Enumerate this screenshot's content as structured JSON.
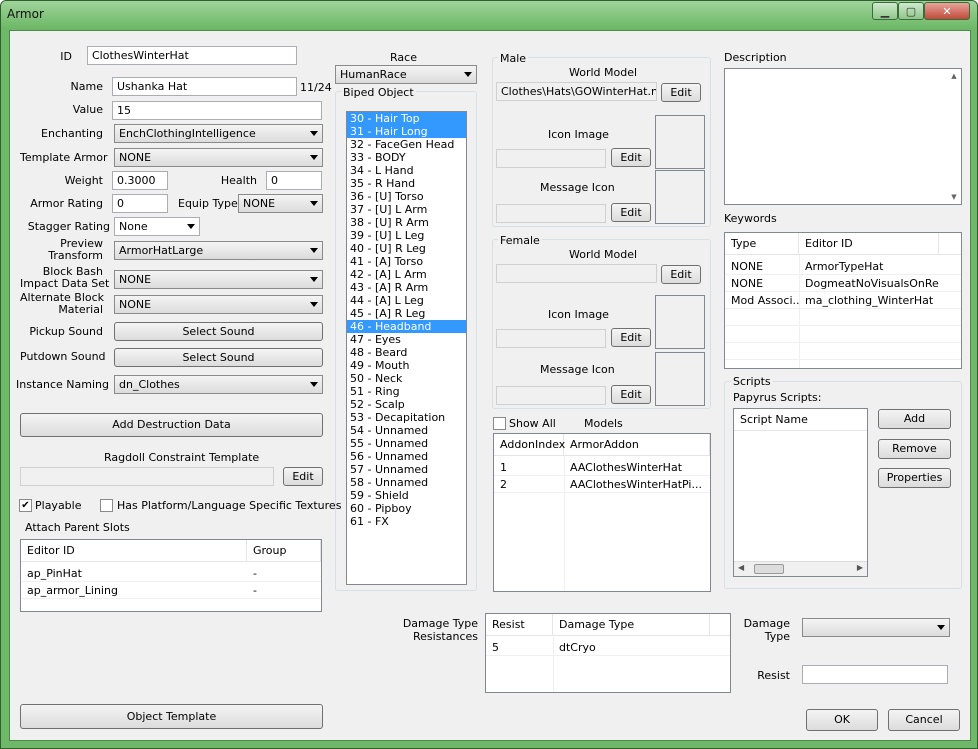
{
  "window": {
    "title": "Armor"
  },
  "left": {
    "id_label": "ID",
    "id_value": "ClothesWinterHat",
    "name_label": "Name",
    "name_value": "Ushanka Hat",
    "name_count": "11/24",
    "value_label": "Value",
    "value_value": "15",
    "enchanting_label": "Enchanting",
    "enchanting_value": "EnchClothingIntelligence",
    "template_label": "Template Armor",
    "template_value": "NONE",
    "weight_label": "Weight",
    "weight_value": "0.3000",
    "health_label": "Health",
    "health_value": "0",
    "armor_rating_label": "Armor Rating",
    "armor_rating_value": "0",
    "equip_type_label": "Equip Type",
    "equip_type_value": "NONE",
    "stagger_label": "Stagger Rating",
    "stagger_value": "None",
    "preview_label_1": "Preview",
    "preview_label_2": "Transform",
    "preview_value": "ArmorHatLarge",
    "bash_label_1": "Block Bash",
    "bash_label_2": "Impact Data Set",
    "bash_value": "NONE",
    "altblock_label_1": "Alternate Block",
    "altblock_label_2": "Material",
    "altblock_value": "NONE",
    "pickup_label": "Pickup Sound",
    "pickup_button": "Select Sound",
    "putdown_label": "Putdown Sound",
    "putdown_button": "Select Sound",
    "instance_label": "Instance Naming",
    "instance_value": "dn_Clothes",
    "destruction_button": "Add Destruction Data",
    "ragdoll_label": "Ragdoll Constraint Template",
    "ragdoll_edit": "Edit",
    "playable_label": "Playable",
    "platform_label": "Has Platform/Language Specific Textures",
    "attach_label": "Attach Parent Slots",
    "attach_cols": [
      "Editor ID",
      "Group"
    ],
    "attach_rows": [
      [
        "ap_PinHat",
        "-"
      ],
      [
        "ap_armor_Lining",
        "-"
      ]
    ],
    "object_template_button": "Object Template"
  },
  "race": {
    "label": "Race",
    "value": "HumanRace"
  },
  "biped": {
    "label": "Biped Object",
    "items": [
      "30 - Hair Top",
      "31 - Hair Long",
      "32 - FaceGen Head",
      "33 - BODY",
      "34 - L Hand",
      "35 - R Hand",
      "36 - [U] Torso",
      "37 - [U] L Arm",
      "38 - [U] R Arm",
      "39 - [U] L Leg",
      "40 - [U] R Leg",
      "41 - [A] Torso",
      "42 - [A] L Arm",
      "43 - [A] R Arm",
      "44 - [A] L Leg",
      "45 - [A] R Leg",
      "46 - Headband",
      "47 - Eyes",
      "48 - Beard",
      "49 - Mouth",
      "50 - Neck",
      "51 - Ring",
      "52 - Scalp",
      "53 - Decapitation",
      "54 - Unnamed",
      "55 - Unnamed",
      "56 - Unnamed",
      "57 - Unnamed",
      "58 - Unnamed",
      "59 - Shield",
      "60 - Pipboy",
      "61 - FX"
    ],
    "selected": [
      0,
      1,
      16
    ]
  },
  "male": {
    "label": "Male",
    "world_model_label": "World Model",
    "world_model_value": "Clothes\\Hats\\GOWinterHat.nif",
    "edit": "Edit",
    "icon_label": "Icon Image",
    "message_label": "Message Icon"
  },
  "female": {
    "label": "Female",
    "world_model_label": "World Model",
    "edit": "Edit",
    "icon_label": "Icon Image",
    "message_label": "Message Icon"
  },
  "models": {
    "show_all": "Show All",
    "label": "Models",
    "cols": [
      "AddonIndex",
      "ArmorAddon"
    ],
    "rows": [
      [
        "1",
        "AAClothesWinterHat"
      ],
      [
        "2",
        "AAClothesWinterHatPi..."
      ]
    ]
  },
  "right": {
    "description_label": "Description",
    "keywords_label": "Keywords",
    "keywords_cols": [
      "Type",
      "Editor ID"
    ],
    "keywords_rows": [
      [
        "NONE",
        "ArmorTypeHat"
      ],
      [
        "NONE",
        "DogmeatNoVisualsOnRe..."
      ],
      [
        "Mod Associ...",
        "ma_clothing_WinterHat"
      ]
    ],
    "scripts_label": "Scripts",
    "papyrus_label": "Papyrus Scripts:",
    "script_col": "Script Name",
    "add_button": "Add",
    "remove_button": "Remove",
    "properties_button": "Properties"
  },
  "damage": {
    "label_1": "Damage Type",
    "label_2": "Resistances",
    "cols": [
      "Resist",
      "Damage Type"
    ],
    "rows": [
      [
        "5",
        "dtCryo"
      ]
    ],
    "type_label_1": "Damage",
    "type_label_2": "Type",
    "resist_label": "Resist"
  },
  "footer": {
    "ok": "OK",
    "cancel": "Cancel"
  }
}
